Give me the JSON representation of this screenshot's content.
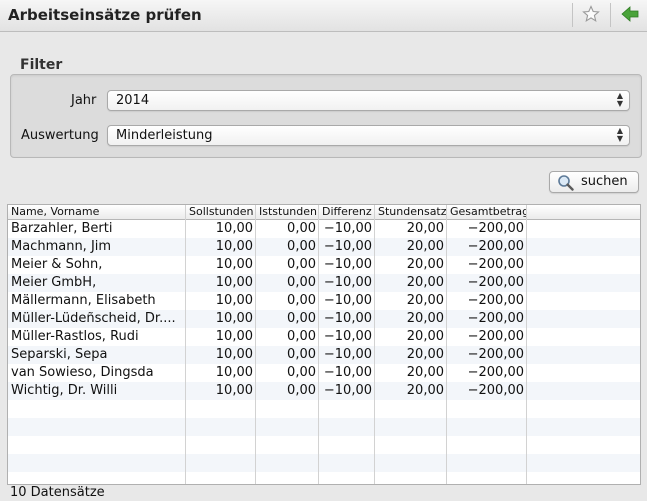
{
  "window": {
    "title": "Arbeitseinsätze prüfen"
  },
  "toolbar": {
    "favorite_icon": "star-icon",
    "back_icon": "back-arrow-icon",
    "back_color": "#4aa33a"
  },
  "filter": {
    "legend": "Filter",
    "year": {
      "label": "Jahr",
      "value": "2014"
    },
    "evaluation": {
      "label": "Auswertung",
      "value": "Minderleistung"
    }
  },
  "search": {
    "label": "suchen",
    "icon": "magnifier-icon"
  },
  "table": {
    "columns": [
      "Name, Vorname",
      "Sollstunden",
      "Iststunden",
      "Differenz",
      "Stundensatz",
      "Gesamtbetrag"
    ],
    "rows": [
      [
        "Barzahler, Berti",
        "10,00",
        "0,00",
        "−10,00",
        "20,00",
        "−200,00"
      ],
      [
        "Machmann, Jim",
        "10,00",
        "0,00",
        "−10,00",
        "20,00",
        "−200,00"
      ],
      [
        "Meier & Sohn,",
        "10,00",
        "0,00",
        "−10,00",
        "20,00",
        "−200,00"
      ],
      [
        "Meier GmbH,",
        "10,00",
        "0,00",
        "−10,00",
        "20,00",
        "−200,00"
      ],
      [
        "Mällermann, Elisabeth",
        "10,00",
        "0,00",
        "−10,00",
        "20,00",
        "−200,00"
      ],
      [
        "Müller-Lüdeñscheid, Dr....",
        "10,00",
        "0,00",
        "−10,00",
        "20,00",
        "−200,00"
      ],
      [
        "Müller-Rastlos, Rudi",
        "10,00",
        "0,00",
        "−10,00",
        "20,00",
        "−200,00"
      ],
      [
        "Separski, Sepa",
        "10,00",
        "0,00",
        "−10,00",
        "20,00",
        "−200,00"
      ],
      [
        "van Sowieso, Dingsda",
        "10,00",
        "0,00",
        "−10,00",
        "20,00",
        "−200,00"
      ],
      [
        "Wichtig, Dr. Willi",
        "10,00",
        "0,00",
        "−10,00",
        "20,00",
        "−200,00"
      ]
    ]
  },
  "status": {
    "count_text": "10 Datensätze"
  }
}
